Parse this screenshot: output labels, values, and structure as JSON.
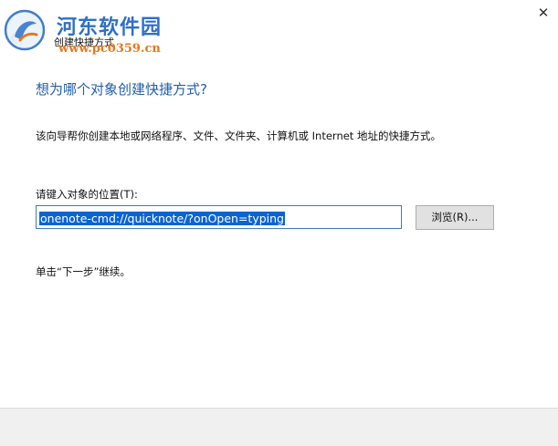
{
  "window": {
    "title": "创建快捷方式",
    "close_glyph": "✕"
  },
  "watermark": {
    "name": "河东软件园",
    "url": "www.pc0359.cn"
  },
  "wizard": {
    "heading": "想为哪个对象创建快捷方式?",
    "description": "该向导帮你创建本地或网络程序、文件、文件夹、计算机或 Internet 地址的快捷方式。",
    "location_label": "请键入对象的位置(T):",
    "location_value": "onenote-cmd://quicknote/?onOpen=typing",
    "browse_label": "浏览(R)...",
    "continue_hint": "单击“下一步”继续。"
  },
  "colors": {
    "heading": "#1f5fa8",
    "selection": "#0a64d2",
    "footer": "#f0f0f0",
    "watermark_name": "#2e6fc8",
    "watermark_url": "#e8781c"
  }
}
